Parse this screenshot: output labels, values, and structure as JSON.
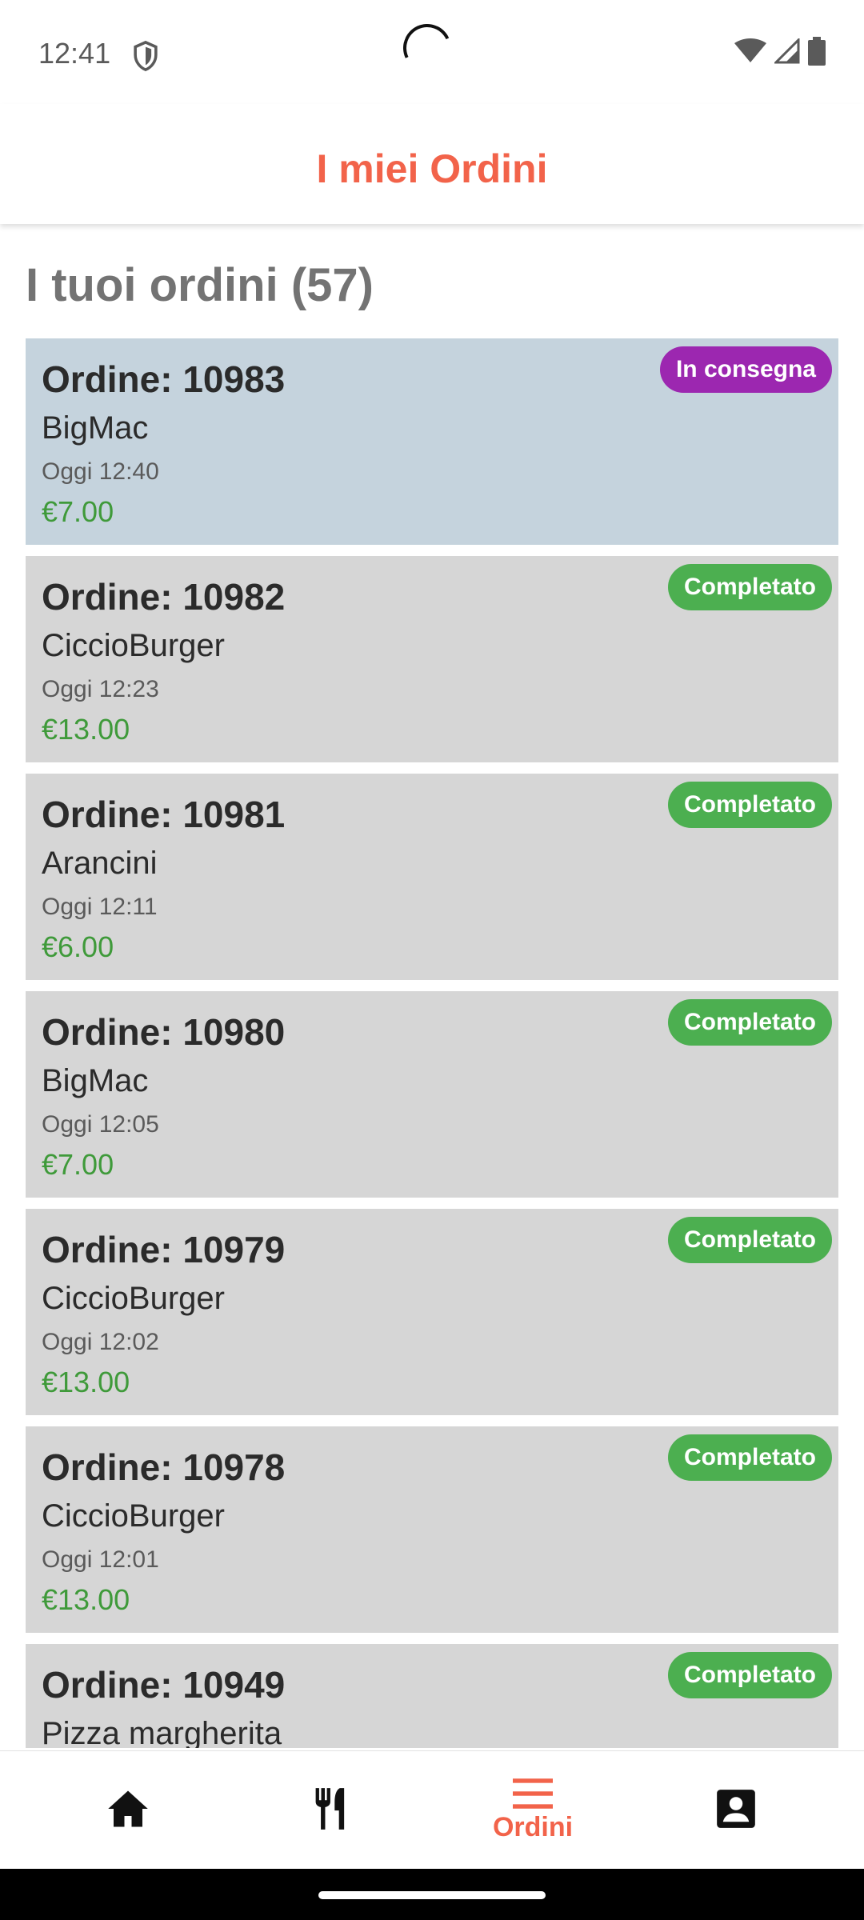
{
  "status_bar": {
    "time": "12:41",
    "icons": [
      "shield-icon",
      "wifi-icon",
      "signal-icon",
      "battery-icon"
    ]
  },
  "header": {
    "title": "I miei Ordini"
  },
  "section": {
    "title": "I tuoi ordini (57)"
  },
  "colors": {
    "brand": "#f2634a",
    "price": "#3f9a3a",
    "badge_delivering": "#9c27b0",
    "badge_completed": "#4caf50",
    "card": "#d6d6d6",
    "card_active": "#c5d3dd"
  },
  "orders": [
    {
      "id": "Ordine: 10983",
      "item": "BigMac",
      "time": "Oggi 12:40",
      "price": "€7.00",
      "status": "In consegna"
    },
    {
      "id": "Ordine: 10982",
      "item": "CiccioBurger",
      "time": "Oggi 12:23",
      "price": "€13.00",
      "status": "Completato"
    },
    {
      "id": "Ordine: 10981",
      "item": "Arancini",
      "time": "Oggi 12:11",
      "price": "€6.00",
      "status": "Completato"
    },
    {
      "id": "Ordine: 10980",
      "item": "BigMac",
      "time": "Oggi 12:05",
      "price": "€7.00",
      "status": "Completato"
    },
    {
      "id": "Ordine: 10979",
      "item": "CiccioBurger",
      "time": "Oggi 12:02",
      "price": "€13.00",
      "status": "Completato"
    },
    {
      "id": "Ordine: 10978",
      "item": "CiccioBurger",
      "time": "Oggi 12:01",
      "price": "€13.00",
      "status": "Completato"
    },
    {
      "id": "Ordine: 10949",
      "item": "Pizza margherita",
      "time": "",
      "price": "",
      "status": "Completato"
    }
  ],
  "bottom_nav": {
    "items": [
      {
        "icon": "home-icon",
        "label": ""
      },
      {
        "icon": "restaurant-icon",
        "label": ""
      },
      {
        "icon": "orders-menu-icon",
        "label": "Ordini"
      },
      {
        "icon": "profile-icon",
        "label": ""
      }
    ]
  }
}
